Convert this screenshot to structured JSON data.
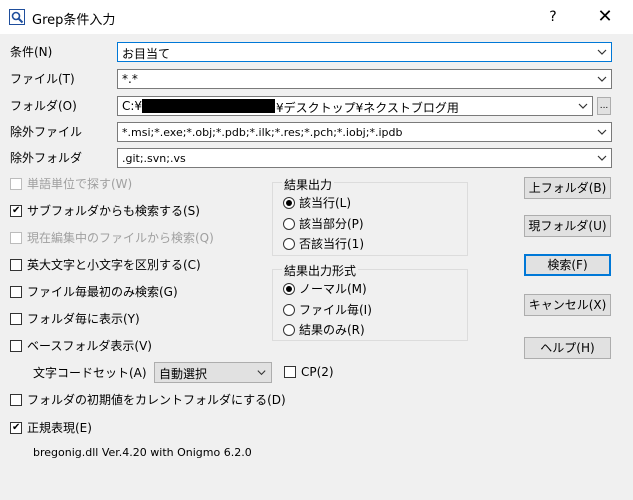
{
  "window": {
    "title": "Grep条件入力",
    "help": "?",
    "close": "✕"
  },
  "fields": {
    "condition": {
      "label": "条件(N)",
      "value": "お目当て"
    },
    "file": {
      "label": "ファイル(T)",
      "value": "*.*"
    },
    "folder": {
      "label": "フォルダ(O)",
      "value_prefix": "C:¥",
      "value_suffix": "¥デスクトップ¥ネクストブログ用",
      "browse": "..."
    },
    "exclude_file": {
      "label": "除外ファイル",
      "value": "*.msi;*.exe;*.obj;*.pdb;*.ilk;*.res;*.pch;*.iobj;*.ipdb"
    },
    "exclude_folder": {
      "label": "除外フォルダ",
      "value": ".git;.svn;.vs"
    }
  },
  "options": {
    "word_unit": {
      "label": "単語単位で探す(W)",
      "checked": false,
      "enabled": false
    },
    "subfolder": {
      "label": "サブフォルダからも検索する(S)",
      "checked": true,
      "enabled": true
    },
    "current_file": {
      "label": "現在編集中のファイルから検索(Q)",
      "checked": false,
      "enabled": false
    },
    "case": {
      "label": "英大文字と小文字を区別する(C)",
      "checked": false,
      "enabled": true
    },
    "first_only": {
      "label": "ファイル毎最初のみ検索(G)",
      "checked": false,
      "enabled": true
    },
    "per_folder": {
      "label": "フォルダ毎に表示(Y)",
      "checked": false,
      "enabled": true
    },
    "base_folder": {
      "label": "ベースフォルダ表示(V)",
      "checked": false,
      "enabled": true
    },
    "charset_label": "文字コードセット(A)",
    "charset_value": "自動選択",
    "cp": {
      "label": "CP(2)",
      "checked": false
    },
    "init_folder": {
      "label": "フォルダの初期値をカレントフォルダにする(D)",
      "checked": false
    },
    "regex": {
      "label": "正規表現(E)",
      "checked": true
    }
  },
  "result_output": {
    "title": "結果出力",
    "items": [
      {
        "label": "該当行(L)",
        "selected": true
      },
      {
        "label": "該当部分(P)",
        "selected": false
      },
      {
        "label": "否該当行(1)",
        "selected": false
      }
    ]
  },
  "result_format": {
    "title": "結果出力形式",
    "items": [
      {
        "label": "ノーマル(M)",
        "selected": true
      },
      {
        "label": "ファイル毎(I)",
        "selected": false
      },
      {
        "label": "結果のみ(R)",
        "selected": false
      }
    ]
  },
  "buttons": {
    "parent_folder": "上フォルダ(B)",
    "current_folder": "現フォルダ(U)",
    "search": "検索(F)",
    "cancel": "キャンセル(X)",
    "help": "ヘルプ(H)"
  },
  "footer": "bregonig.dll Ver.4.20 with Onigmo 6.2.0"
}
